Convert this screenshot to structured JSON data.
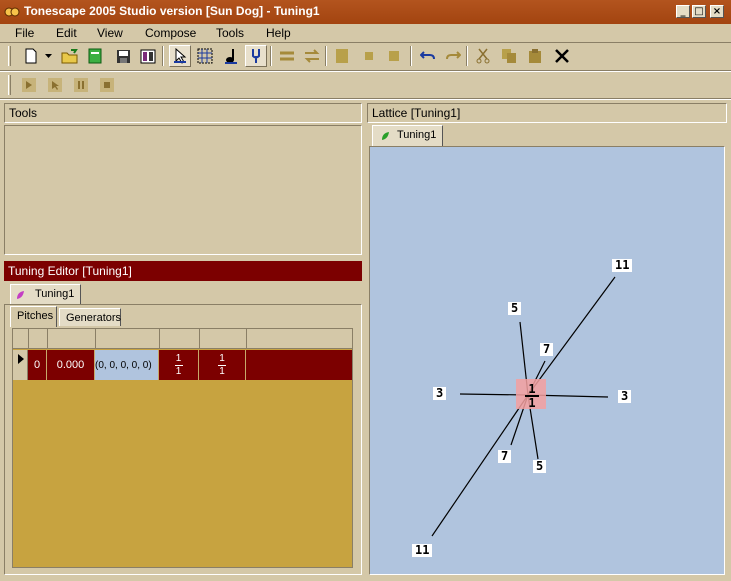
{
  "window": {
    "title": "Tonescape 2005 Studio  version [Sun Dog]  -  Tuning1",
    "controls": [
      "_",
      "□",
      "×"
    ]
  },
  "menu": [
    "File",
    "Edit",
    "View",
    "Compose",
    "Tools",
    "Help"
  ],
  "toolbar": {
    "main_icons": [
      "new-icon",
      "dropdown-arrow-icon",
      "open-icon",
      "import-icon",
      "save-icon",
      "properties-icon",
      "pointer-icon",
      "grid-select-icon",
      "note-icon",
      "tuning-fork-icon",
      "align-icon",
      "loop-icon",
      "block-icon",
      "small-block-icon",
      "small-block2-icon",
      "undo-icon",
      "redo-icon",
      "cut-icon",
      "copy-icon",
      "paste-icon",
      "delete-icon"
    ],
    "transport_icons": [
      "play-icon",
      "play-from-cursor-icon",
      "pause-icon",
      "stop-icon"
    ]
  },
  "panels": {
    "tools_title": "Tools",
    "tuning_editor_title": "Tuning Editor  [Tuning1]",
    "tuning_tab": "Tuning1",
    "subtabs": [
      "Pitches",
      "Generators"
    ],
    "lattice_title": "Lattice  [Tuning1]",
    "lattice_tab": "Tuning1"
  },
  "pitch_table": {
    "rows": [
      {
        "index": "0",
        "cents": "0.000",
        "vector": "(0, 0, 0, 0, 0)",
        "ratio_num": "1",
        "ratio_den": "1",
        "ratio2_num": "1",
        "ratio2_den": "1"
      }
    ]
  },
  "lattice": {
    "center": {
      "num": "1",
      "den": "1"
    },
    "labels": [
      "11",
      "5",
      "7",
      "3",
      "3",
      "7",
      "5",
      "11"
    ]
  },
  "colors": {
    "titlebar": "#a34410",
    "panel_bg": "#d4c8a8",
    "editor_header": "#7c0000",
    "grid_bg": "#c7a340",
    "selected_row": "#7c0000",
    "vector_cell": "#b0c4de",
    "lattice_bg": "#b0c4de",
    "center_node": "#f4a0a0"
  }
}
